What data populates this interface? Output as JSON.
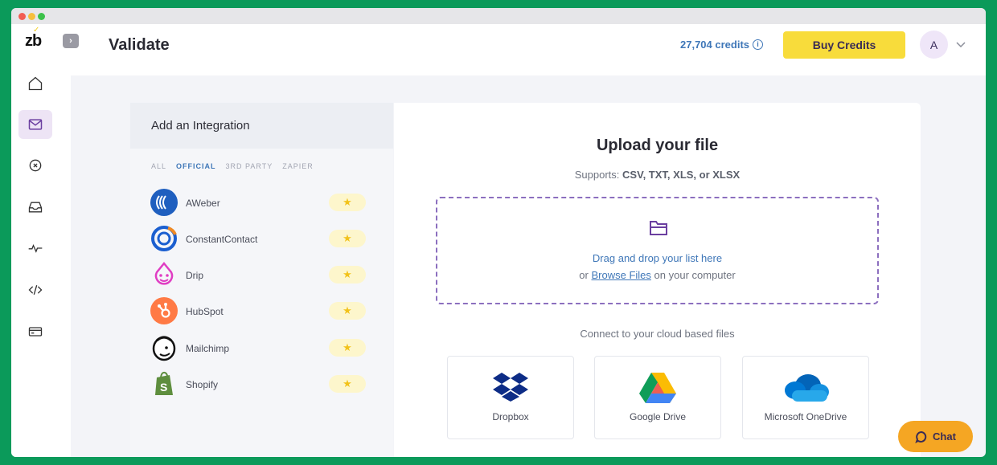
{
  "app": {
    "logo": "zb",
    "page_title": "Validate"
  },
  "header": {
    "credits": "27,704 credits",
    "info_icon": "info-icon",
    "buy_label": "Buy Credits",
    "avatar_initial": "A"
  },
  "sidebar": {
    "items": [
      {
        "icon": "home-icon",
        "active": false
      },
      {
        "icon": "mail-icon",
        "active": true
      },
      {
        "icon": "blocked-icon",
        "active": false
      },
      {
        "icon": "inbox-icon",
        "active": false
      },
      {
        "icon": "activity-icon",
        "active": false
      },
      {
        "icon": "code-icon",
        "active": false
      },
      {
        "icon": "card-icon",
        "active": false
      }
    ]
  },
  "integrations": {
    "title": "Add an Integration",
    "filters": [
      "ALL",
      "OFFICIAL",
      "3RD PARTY",
      "ZAPIER"
    ],
    "active_filter": "OFFICIAL",
    "items": [
      {
        "name": "AWeber",
        "star": "★"
      },
      {
        "name": "ConstantContact",
        "star": "★"
      },
      {
        "name": "Drip",
        "star": "★"
      },
      {
        "name": "HubSpot",
        "star": "★"
      },
      {
        "name": "Mailchimp",
        "star": "★"
      },
      {
        "name": "Shopify",
        "star": "★"
      }
    ]
  },
  "upload": {
    "title": "Upload your file",
    "supports_prefix": "Supports:",
    "supports_formats": "CSV, TXT, XLS, or XLSX",
    "drag_text": "Drag and drop your list here",
    "browse_prefix": "or",
    "browse_link": "Browse Files",
    "browse_suffix": "on your computer",
    "cloud_text": "Connect to your cloud based files",
    "cloud_services": [
      {
        "label": "Dropbox",
        "icon": "dropbox-icon"
      },
      {
        "label": "Google Drive",
        "icon": "google-drive-icon"
      },
      {
        "label": "Microsoft OneDrive",
        "icon": "onedrive-icon"
      }
    ]
  },
  "chat": {
    "label": "Chat"
  },
  "colors": {
    "accent_yellow": "#f8dc3b",
    "link_blue": "#3f77b8",
    "purple": "#6b3fa0",
    "chat_orange": "#f5a623",
    "frame_green": "#0b9a5a"
  }
}
